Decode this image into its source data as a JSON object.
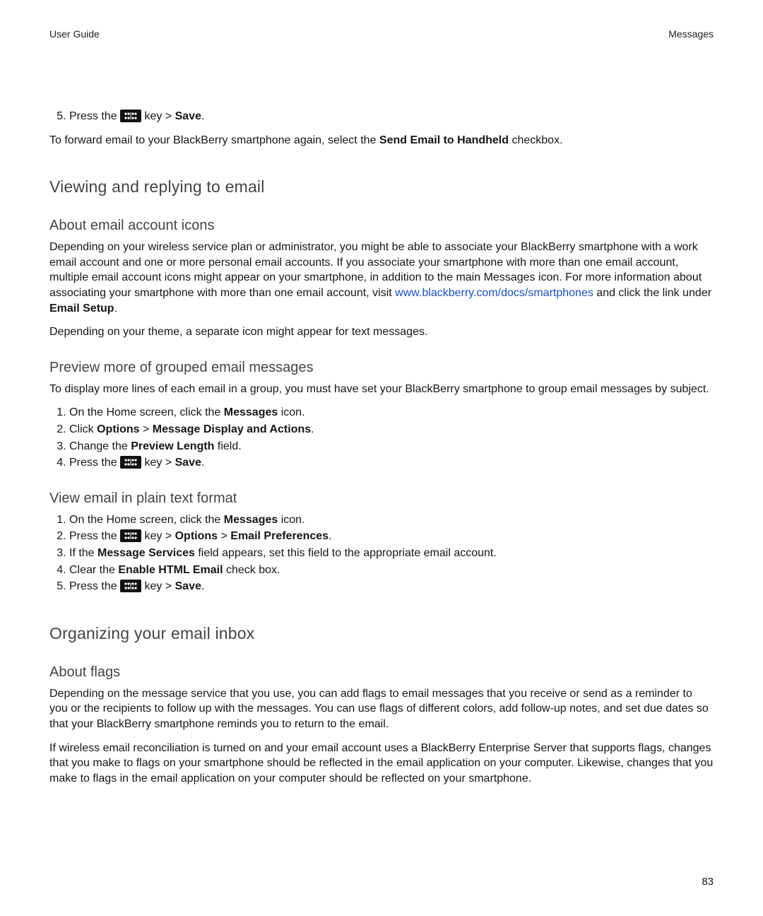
{
  "header": {
    "left": "User Guide",
    "right": "Messages"
  },
  "page_number": "83",
  "step5": {
    "number": "5.",
    "press_the": "Press the ",
    "key_gt": " key > ",
    "save": "Save",
    "dot": "."
  },
  "forward_para": {
    "a": "To forward email to your BlackBerry smartphone again, select the ",
    "b": "Send Email to Handheld",
    "c": " checkbox."
  },
  "h2_viewing": "Viewing and replying to email",
  "h3_about_icons": "About email account icons",
  "about_icons_para": {
    "a": "Depending on your wireless service plan or administrator, you might be able to associate your BlackBerry smartphone with a work email account and one or more personal email accounts. If you associate your smartphone with more than one email account, multiple email account icons might appear on your smartphone, in addition to the main Messages icon. For more information about associating your smartphone with more than one email account, visit ",
    "link": "www.blackberry.com/docs/smartphones",
    "b": " and click the link under ",
    "bold": "Email Setup",
    "c": "."
  },
  "about_icons_para2": "Depending on your theme, a separate icon might appear for text messages.",
  "h3_preview": "Preview more of grouped email messages",
  "preview_intro": "To display more lines of each email in a group, you must have set your BlackBerry smartphone to group email messages by subject.",
  "preview_steps": {
    "s1": {
      "a": "On the Home screen, click the ",
      "b": "Messages",
      "c": " icon."
    },
    "s2": {
      "a": "Click ",
      "b": "Options",
      "gt": " > ",
      "c": "Message Display and Actions",
      "d": "."
    },
    "s3": {
      "a": "Change the ",
      "b": "Preview Length",
      "c": " field."
    },
    "s4": {
      "press_the": "Press the ",
      "key_gt": " key > ",
      "save": "Save",
      "dot": "."
    }
  },
  "h3_plain": "View email in plain text format",
  "plain_steps": {
    "s1": {
      "a": "On the Home screen, click the ",
      "b": "Messages",
      "c": " icon."
    },
    "s2": {
      "press_the": "Press the ",
      "key_gt": " key > ",
      "opt": "Options",
      "gt": " > ",
      "pref": "Email Preferences",
      "dot": "."
    },
    "s3": {
      "a": "If the ",
      "b": "Message Services",
      "c": " field appears, set this field to the appropriate email account."
    },
    "s4": {
      "a": "Clear the ",
      "b": "Enable HTML Email",
      "c": " check box."
    },
    "s5": {
      "press_the": "Press the ",
      "key_gt": " key > ",
      "save": "Save",
      "dot": "."
    }
  },
  "h2_org": "Organizing your email inbox",
  "h3_flags": "About flags",
  "flags_p1": "Depending on the message service that you use, you can add flags to email messages that you receive or send as a reminder to you or the recipients to follow up with the messages. You can use flags of different colors, add follow-up notes, and set due dates so that your BlackBerry smartphone reminds you to return to the email.",
  "flags_p2": "If wireless email reconciliation is turned on and your email account uses a BlackBerry Enterprise Server that supports flags, changes that you make to flags on your smartphone should be reflected in the email application on your computer. Likewise, changes that you make to flags in the email application on your computer should be reflected on your smartphone."
}
